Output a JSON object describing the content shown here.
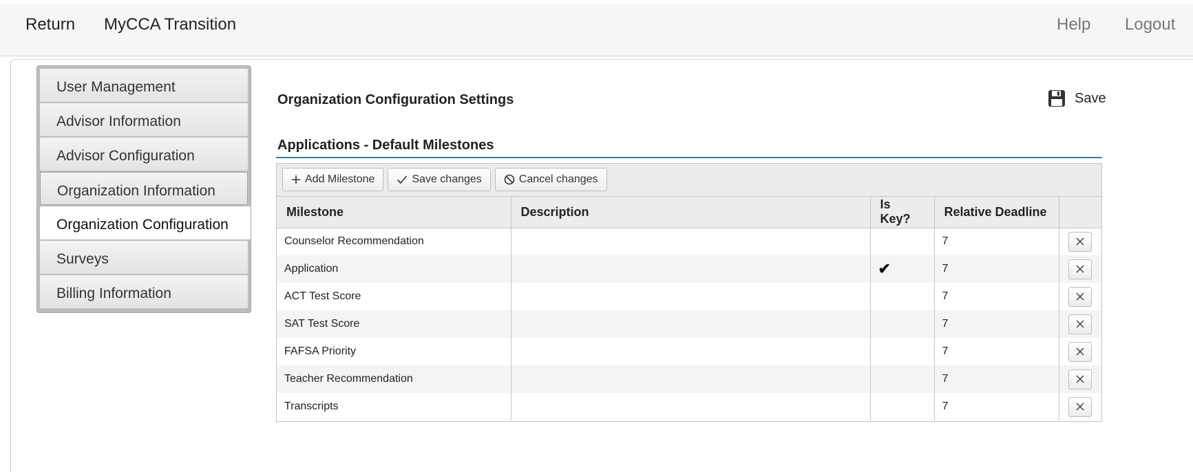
{
  "header": {
    "return_label": "Return",
    "app_title": "MyCCA Transition",
    "help_label": "Help",
    "logout_label": "Logout"
  },
  "sidebar": {
    "items": [
      {
        "label": "User Management"
      },
      {
        "label": "Advisor Information"
      },
      {
        "label": "Advisor Configuration"
      },
      {
        "label": "Organization Information"
      },
      {
        "label": "Organization Configuration"
      },
      {
        "label": "Surveys"
      },
      {
        "label": "Billing Information"
      }
    ],
    "active_index": 4
  },
  "main": {
    "page_title": "Organization Configuration Settings",
    "save_label": "Save",
    "save_icon": "floppy-disk-icon",
    "section_title": "Applications - Default Milestones"
  },
  "grid": {
    "toolbar": {
      "add_label": "Add Milestone",
      "save_label": "Save changes",
      "cancel_label": "Cancel changes"
    },
    "columns": [
      "Milestone",
      "Description",
      "Is Key?",
      "Relative Deadline",
      ""
    ],
    "rows": [
      {
        "milestone": "Counselor Recommendation",
        "description": "",
        "is_key": "",
        "deadline": "7"
      },
      {
        "milestone": "Application",
        "description": "",
        "is_key": "✔",
        "deadline": "7"
      },
      {
        "milestone": "ACT Test Score",
        "description": "",
        "is_key": "",
        "deadline": "7"
      },
      {
        "milestone": "SAT Test Score",
        "description": "",
        "is_key": "",
        "deadline": "7"
      },
      {
        "milestone": "FAFSA Priority",
        "description": "",
        "is_key": "",
        "deadline": "7"
      },
      {
        "milestone": "Teacher Recommendation",
        "description": "",
        "is_key": "",
        "deadline": "7"
      },
      {
        "milestone": "Transcripts",
        "description": "",
        "is_key": "",
        "deadline": "7"
      }
    ]
  },
  "colors": {
    "accent_rule": "#3f7a99",
    "sidebar_frame": "#bdbdbd",
    "header_bg": "#f6f6f6"
  }
}
